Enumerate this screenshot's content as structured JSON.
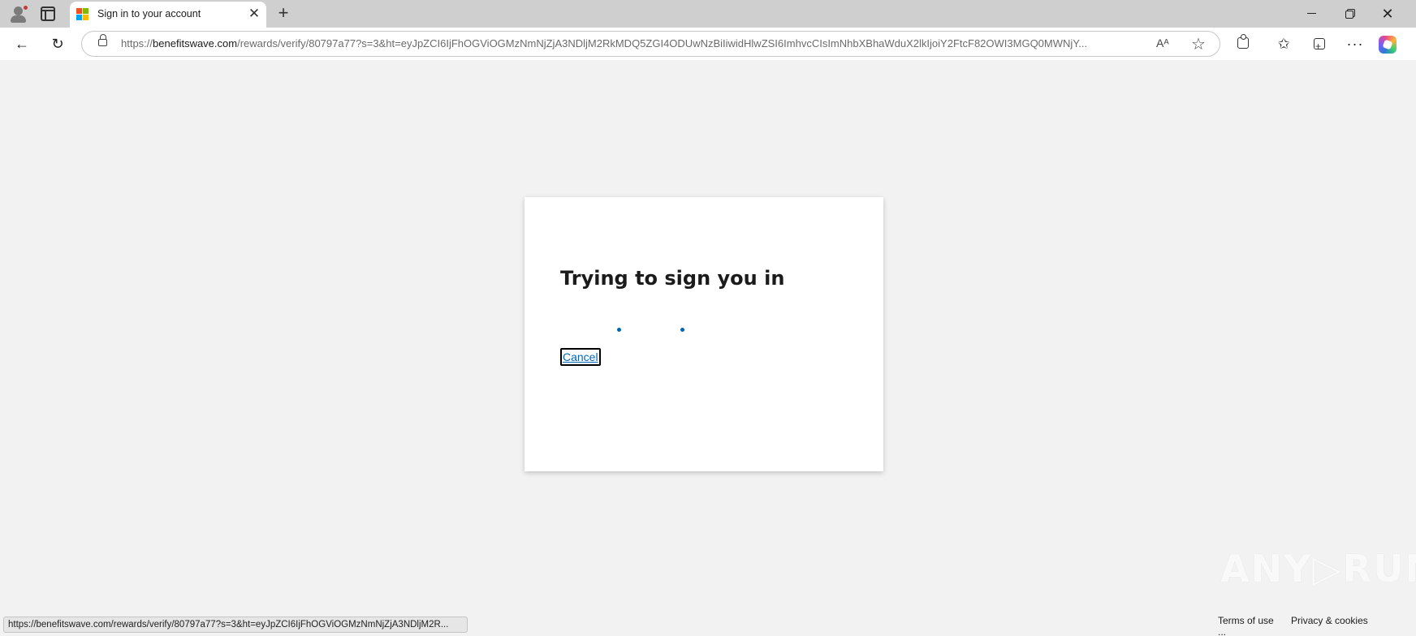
{
  "tab": {
    "title": "Sign in to your account",
    "close_glyph": "✕",
    "new_tab_glyph": "+"
  },
  "window_controls": {
    "close_glyph": "✕"
  },
  "toolbar": {
    "back_glyph": "←",
    "reload_glyph": "↻",
    "url_prefix": "https://",
    "url_host": "benefitswave.com",
    "url_path": "/rewards/verify/80797a77?s=3&ht=eyJpZCI6IjFhOGViOGMzNmNjZjA3NDljM2RkMDQ5ZGI4ODUwNzBiIiwidHlwZSI6ImhvcCIsImNhbXBhaWduX2lkIjoiY2FtcF82OWI3MGQ0MWNjY...",
    "read_aloud_glyph": "Aᴬ",
    "favorite_glyph": "☆",
    "favorites_glyph": "✩",
    "more_glyph": "···"
  },
  "card": {
    "title": "Trying to sign you in",
    "cancel_label": "Cancel"
  },
  "watermark": "ANY▷RUN",
  "footer": {
    "terms": "Terms of use",
    "privacy": "Privacy & cookies",
    "more": "..."
  },
  "status_bar_url": "https://benefitswave.com/rewards/verify/80797a77?s=3&ht=eyJpZCI6IjFhOGViOGMzNmNjZjA3NDljM2R..."
}
